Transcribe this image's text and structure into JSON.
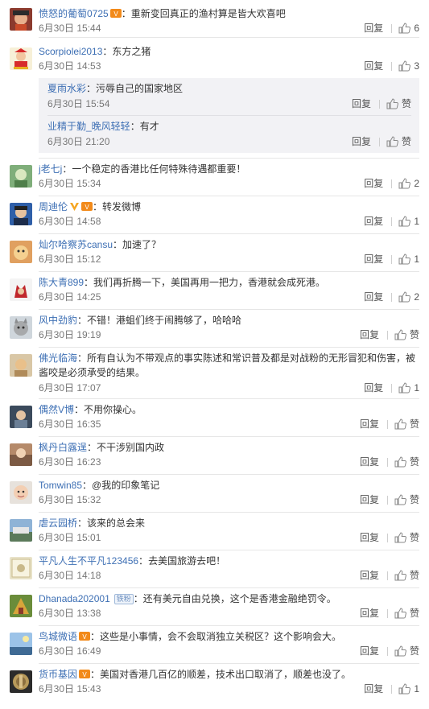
{
  "actions": {
    "reply": "回复",
    "like": "赞"
  },
  "comments": [
    {
      "user": "愤怒的葡萄0725",
      "text": "重新变回真正的渔村算是皆大欢喜吧",
      "time": "6月30日 15:44",
      "likes": "6"
    },
    {
      "user": "Scorpiolei2013",
      "text": "东方之猪",
      "time": "6月30日 14:53",
      "likes": "3",
      "replies": [
        {
          "user": "夏雨水彩",
          "text": "污辱自己的国家地区",
          "time": "6月30日 15:54",
          "likes": "赞"
        },
        {
          "user": "业精于勤_晚风轻轻",
          "text": "有才",
          "time": "6月30日 21:20",
          "likes": "赞"
        }
      ]
    },
    {
      "user": "j老七j",
      "text": "一个稳定的香港比任何特殊待遇都重要！",
      "time": "6月30日 15:34",
      "likes": "2"
    },
    {
      "user": "周迪伦",
      "text": "转发微博",
      "time": "6月30日 14:58",
      "likes": "1"
    },
    {
      "user": "灿尔哈察苏cansu",
      "text": "加速了？",
      "time": "6月30日 15:12",
      "likes": "1"
    },
    {
      "user": "陈大青899",
      "text": "我们再折腾一下，美国再用一把力，香港就会成死港。",
      "time": "6月30日 14:25",
      "likes": "2"
    },
    {
      "user": "风中劲豹",
      "text": "不错！港蛆们终于闹腾够了，哈哈哈",
      "time": "6月30日 19:19",
      "likes": "赞"
    },
    {
      "user": "佛光临海",
      "text": "所有自认为不带观点的事实陈述和常识普及都是对战粉的无形冒犯和伤害，被酱咬是必须承受的结果。",
      "time": "6月30日 17:07",
      "likes": "1"
    },
    {
      "user": "偶然V博",
      "text": "不用你操心。",
      "time": "6月30日 16:35",
      "likes": "赞"
    },
    {
      "user": "枫丹白露逞",
      "text": "不干涉别国内政",
      "time": "6月30日 16:23",
      "likes": "赞"
    },
    {
      "user": "Tomwin85",
      "text": "@我的印象笔记",
      "time": "6月30日 15:32",
      "likes": "赞"
    },
    {
      "user": "虐云园桥",
      "text": "该来的总会来",
      "time": "6月30日 15:01",
      "likes": "赞"
    },
    {
      "user": "平凡人生不平凡123456",
      "text": "去美国旅游去吧！",
      "time": "6月30日 14:18",
      "likes": "赞"
    },
    {
      "user": "Dhanada202001",
      "tag": "铁粉",
      "text": "还有美元自由兑换，这个是香港金融绝罚令。",
      "time": "6月30日 13:38",
      "likes": "赞"
    },
    {
      "user": "鸟城微语",
      "text": "这些是小事情，会不会取消独立关税区？这个影响会大。",
      "time": "6月30日 16:49",
      "likes": "赞"
    },
    {
      "user": "货币基因",
      "text": "美国对香港几百亿的顺差，技术出口取消了，顺差也没了。",
      "time": "6月30日 15:43",
      "likes": "1"
    }
  ],
  "colors": {
    "username": "#3d6fb4",
    "meta": "#777777",
    "subBg": "#f2f2f5"
  }
}
